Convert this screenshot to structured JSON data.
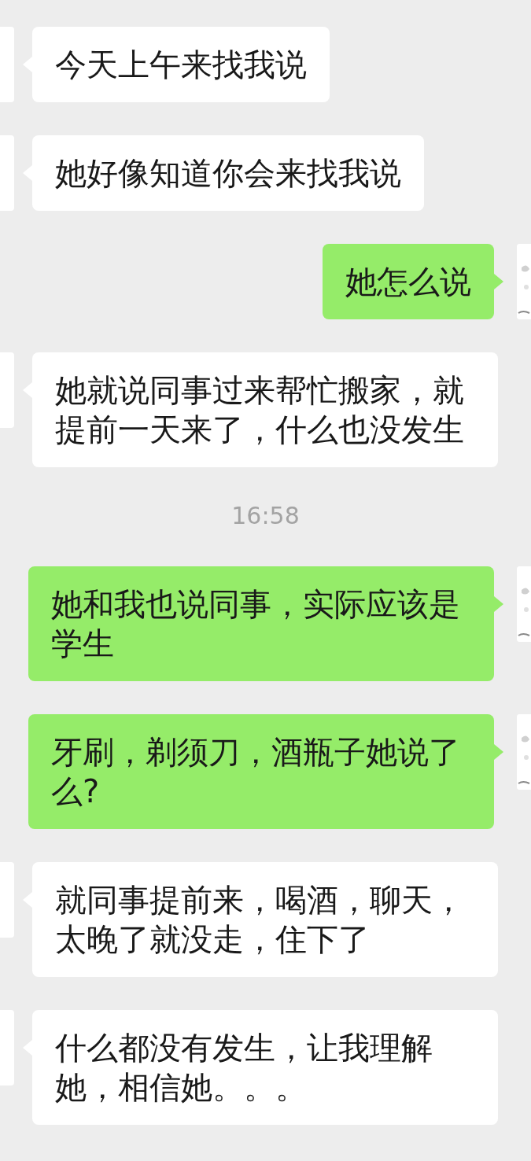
{
  "messages": [
    {
      "kind": "message",
      "outgoing": false,
      "text": "今天上午来找我说"
    },
    {
      "kind": "message",
      "outgoing": false,
      "text": "她好像知道你会来找我说"
    },
    {
      "kind": "message",
      "outgoing": true,
      "text": "她怎么说"
    },
    {
      "kind": "message",
      "outgoing": false,
      "text": "她就说同事过来帮忙搬家，就提前一天来了，什么也没发生"
    },
    {
      "kind": "time",
      "text": "16:58"
    },
    {
      "kind": "message",
      "outgoing": true,
      "text": "她和我也说同事，实际应该是学生"
    },
    {
      "kind": "message",
      "outgoing": true,
      "text": "牙刷，剃须刀，酒瓶子她说了么?"
    },
    {
      "kind": "message",
      "outgoing": false,
      "text": "就同事提前来，喝酒，聊天，太晚了就没走，住下了"
    },
    {
      "kind": "message",
      "outgoing": false,
      "text": "什么都没有发生，让我理解她，相信她。。。"
    }
  ]
}
